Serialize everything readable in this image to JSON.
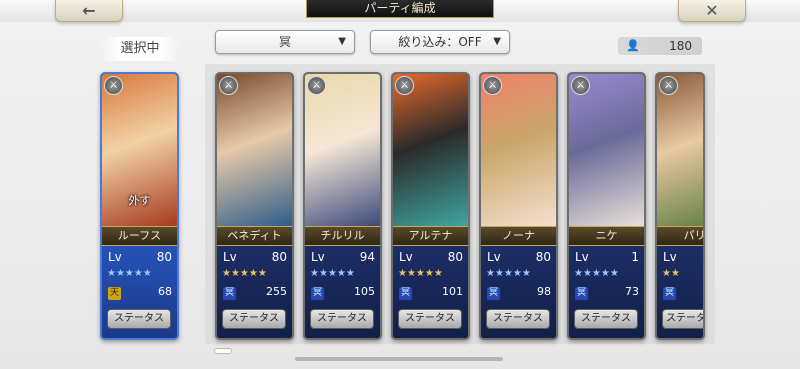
{
  "header": {
    "back_icon": "←",
    "close_icon": "✕",
    "title": "パーティ編成"
  },
  "selected_label": "選択中",
  "filters": {
    "attribute": "冥",
    "narrow": "絞り込み：OFF"
  },
  "member_count": "180",
  "cards": [
    {
      "name": "ルーフス",
      "lv_label": "Lv",
      "lv": "80",
      "stars": "★★★★★",
      "star_color": "blue",
      "stat": "68",
      "stat_icon": "天",
      "stat_icon_color": "gold",
      "status_label": "ステータス",
      "remove_label": "外す",
      "type": "⚔",
      "colors": [
        "#d9783a",
        "#a63a1f",
        "#f1d1a6"
      ]
    },
    {
      "name": "ベネディト",
      "lv_label": "Lv",
      "lv": "80",
      "stars": "★★★★★",
      "star_color": "gold",
      "stat": "255",
      "stat_icon": "冥",
      "stat_icon_color": "blue",
      "status_label": "ステータス",
      "type": "⚔",
      "colors": [
        "#7a4a2a",
        "#2f5d8a",
        "#e6c9a8"
      ]
    },
    {
      "name": "チルリル",
      "lv_label": "Lv",
      "lv": "94",
      "stars": "★★★★★",
      "star_color": "blue",
      "stat": "105",
      "stat_icon": "冥",
      "stat_icon_color": "blue",
      "status_label": "ステータス",
      "type": "⚔",
      "colors": [
        "#e8d9a8",
        "#3b4a7a",
        "#f5e6d6"
      ]
    },
    {
      "name": "アルテナ",
      "lv_label": "Lv",
      "lv": "80",
      "stars": "★★★★★",
      "star_color": "gold",
      "stat": "101",
      "stat_icon": "冥",
      "stat_icon_color": "blue",
      "status_label": "ステータス",
      "type": "⚔",
      "colors": [
        "#e86a2a",
        "#3fa6a0",
        "#2a2a2a"
      ]
    },
    {
      "name": "ノーナ",
      "lv_label": "Lv",
      "lv": "80",
      "stars": "★★★★★",
      "star_color": "blue",
      "stat": "98",
      "stat_icon": "冥",
      "stat_icon_color": "blue",
      "status_label": "ステータス",
      "type": "⚔",
      "colors": [
        "#f0806a",
        "#f5e0d0",
        "#c9a66a"
      ]
    },
    {
      "name": "ニケ",
      "lv_label": "Lv",
      "lv": "1",
      "stars": "★★★★★",
      "star_color": "blue",
      "stat": "73",
      "stat_icon": "冥",
      "stat_icon_color": "blue",
      "status_label": "ステータス",
      "type": "⚔",
      "colors": [
        "#9a8ad0",
        "#e8e0d8",
        "#6a6a9a"
      ]
    },
    {
      "name": "パリ",
      "lv_label": "Lv",
      "lv": "",
      "stars": "★★",
      "star_color": "gold",
      "stat": "",
      "stat_icon": "冥",
      "stat_icon_color": "blue",
      "status_label": "ステータ",
      "type": "⚔",
      "colors": [
        "#8a5a3a",
        "#5a7a3a",
        "#e8c9a0"
      ]
    }
  ]
}
